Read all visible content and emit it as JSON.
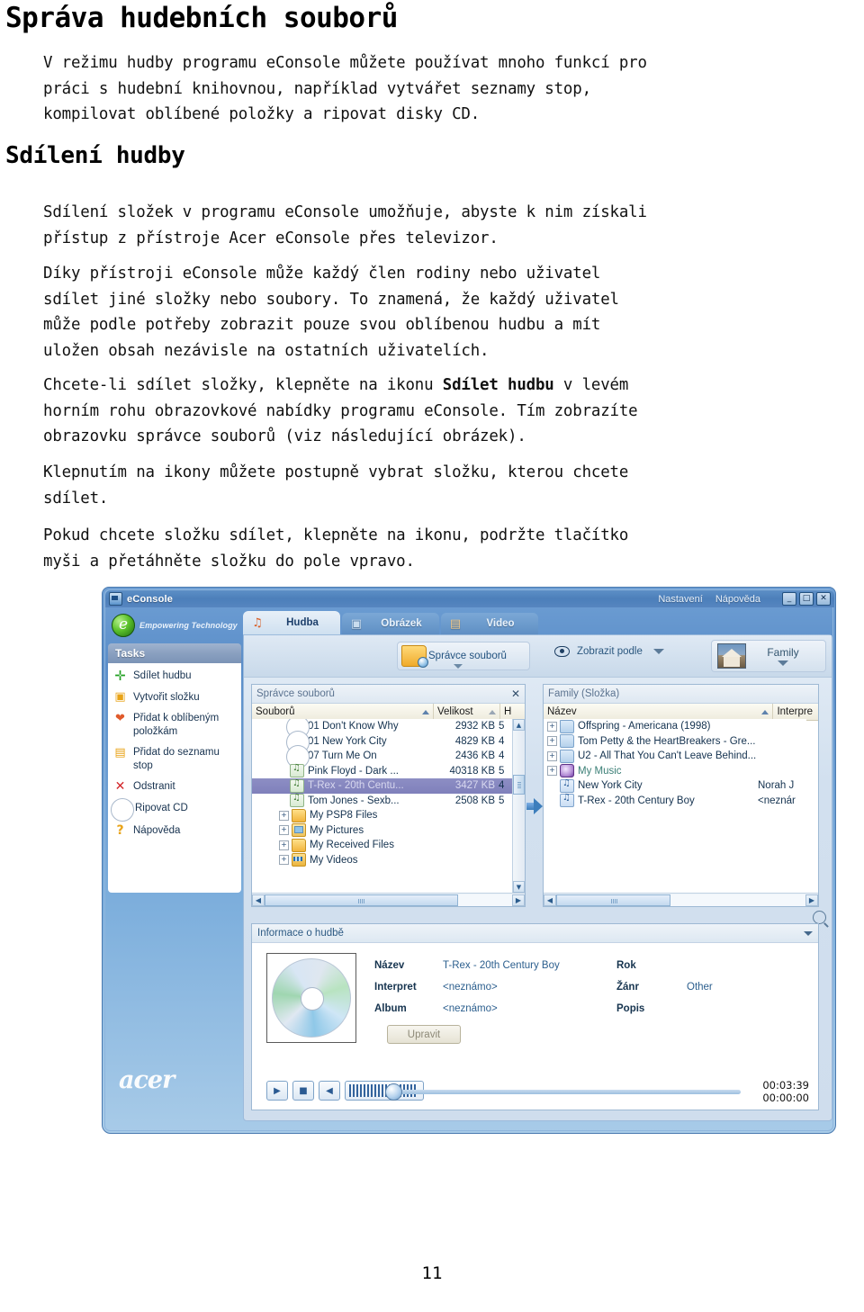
{
  "document": {
    "heading1": "Správa hudebních souborů",
    "heading2": "Sdílení hudby",
    "paragraphs": {
      "p1": "V režimu hudby programu eConsole můžete používat mnoho funkcí pro\npráci s hudební knihovnou, například vytvářet seznamy stop,\nkompilovat oblíbené položky a ripovat disky CD.",
      "p2": "Sdílení složek v programu eConsole umožňuje, abyste k nim získali\npřístup z přístroje Acer eConsole přes televizor.",
      "p3": "Díky přístroji eConsole může každý člen rodiny nebo uživatel\nsdílet jiné složky nebo soubory. To znamená, že každý uživatel\nmůže podle potřeby zobrazit pouze svou oblíbenou hudbu a mít\nuložen obsah nezávisle na ostatních uživatelích.",
      "p4_a": "Chcete-li sdílet složky, klepněte na ikonu ",
      "p4_bold": "Sdílet hudbu",
      "p4_b": " v levém\nhorním rohu obrazovkové nabídky programu eConsole. Tím zobrazíte\nobrazovku správce souborů (viz následující obrázek).",
      "p5": "Klepnutím na ikony můžete postupně vybrat složku, kterou chcete\nsdílet.",
      "p6": "Pokud chcete složku sdílet, klepněte na ikonu, podržte tlačítko\nmyši a přetáhněte složku do pole vpravo."
    },
    "page_number": "11"
  },
  "screenshot": {
    "titlebar": {
      "app_name": "eConsole",
      "settings_label": "Nastavení",
      "help_label": "Nápověda",
      "minimize": "_",
      "maximize": "□",
      "close": "✕"
    },
    "sidebar": {
      "brand": "Empowering Technology",
      "tasks_header": "Tasks",
      "tasks": [
        {
          "label": "Sdílet hudbu",
          "icon": "plus-icon",
          "glyph": "✛"
        },
        {
          "label": "Vytvořit složku",
          "icon": "new-folder-icon",
          "glyph": "▣"
        },
        {
          "label": "Přidat k oblíbeným položkám",
          "icon": "favorites-heart-icon",
          "glyph": "❤"
        },
        {
          "label": "Přidat do seznamu stop",
          "icon": "playlist-folder-icon",
          "glyph": "▤"
        },
        {
          "label": "Odstranit",
          "icon": "delete-x-icon",
          "glyph": "✕"
        },
        {
          "label": "Ripovat CD",
          "icon": "rip-cd-icon",
          "glyph": "◉"
        },
        {
          "label": "Nápověda",
          "icon": "help-question-icon",
          "glyph": "?"
        }
      ],
      "brand_logo": "acer"
    },
    "tabs": [
      {
        "label": "Hudba",
        "icon": "music-note-icon",
        "glyph": "♫",
        "active": true
      },
      {
        "label": "Obrázek",
        "icon": "camera-icon",
        "glyph": "▣",
        "active": false
      },
      {
        "label": "Video",
        "icon": "filmstrip-icon",
        "glyph": "▤",
        "active": false
      }
    ],
    "toolbar": {
      "file_manager_label": "Správce souborů",
      "view_by_label": "Zobrazit podle",
      "family_label": "Family"
    },
    "left_pane": {
      "title": "Správce souborů",
      "close": "✕",
      "columns": [
        "Souborů",
        "Velikost",
        "H"
      ],
      "rows": [
        {
          "name": "01 Don't Know Why",
          "size": "2932 KB",
          "tail": "5",
          "icon": "cd-track-icon",
          "type": "cd",
          "selected": false,
          "indent": 2
        },
        {
          "name": "01 New York City",
          "size": "4829 KB",
          "tail": "4",
          "icon": "cd-track-icon",
          "type": "cd",
          "selected": false,
          "indent": 2
        },
        {
          "name": "07 Turn Me On",
          "size": "2436 KB",
          "tail": "4",
          "icon": "cd-track-icon",
          "type": "cd",
          "selected": false,
          "indent": 2
        },
        {
          "name": "Pink Floyd - Dark ...",
          "size": "40318 KB",
          "tail": "5",
          "icon": "music-file-icon",
          "type": "note",
          "selected": false,
          "indent": 2
        },
        {
          "name": "T-Rex - 20th Centu...",
          "size": "3427 KB",
          "tail": "4",
          "icon": "music-file-icon",
          "type": "note",
          "selected": true,
          "indent": 2
        },
        {
          "name": "Tom Jones - Sexb...",
          "size": "2508 KB",
          "tail": "5",
          "icon": "music-file-icon",
          "type": "note",
          "selected": false,
          "indent": 2
        },
        {
          "name": "My PSP8 Files",
          "size": "",
          "tail": "",
          "icon": "folder-icon",
          "type": "fold",
          "selected": false,
          "indent": 1,
          "expander": "+"
        },
        {
          "name": "My Pictures",
          "size": "",
          "tail": "",
          "icon": "pictures-folder-icon",
          "type": "pic",
          "selected": false,
          "indent": 1,
          "expander": "+"
        },
        {
          "name": "My Received Files",
          "size": "",
          "tail": "",
          "icon": "folder-icon",
          "type": "fold",
          "selected": false,
          "indent": 1,
          "expander": "+"
        },
        {
          "name": "My Videos",
          "size": "",
          "tail": "",
          "icon": "videos-folder-icon",
          "type": "vid",
          "selected": false,
          "indent": 1,
          "expander": "+"
        }
      ]
    },
    "right_pane": {
      "title": "Family (Složka)",
      "columns": [
        "Název",
        "Interpre"
      ],
      "rows": [
        {
          "name": "Offspring - Americana (1998)",
          "artist": "",
          "icon": "folder-icon",
          "type": "fold-blue",
          "expander": "+"
        },
        {
          "name": "Tom Petty & the HeartBreakers - Gre...",
          "artist": "",
          "icon": "folder-icon",
          "type": "fold-blue",
          "expander": "+"
        },
        {
          "name": "U2 - All That You Can't Leave Behind...",
          "artist": "",
          "icon": "folder-icon",
          "type": "fold-blue",
          "expander": "+"
        },
        {
          "name": "My Music",
          "artist": "",
          "icon": "my-music-icon",
          "type": "mymusic",
          "expander": "+",
          "teal": true
        },
        {
          "name": "New York City",
          "artist": "Norah J",
          "icon": "music-file-icon",
          "type": "note-blue",
          "expander": ""
        },
        {
          "name": "T-Rex - 20th Century Boy",
          "artist": "<neznár",
          "icon": "music-file-icon",
          "type": "note-blue",
          "expander": ""
        }
      ]
    },
    "info_panel": {
      "title": "Informace o hudbě",
      "fields_left": [
        {
          "key": "Název",
          "value": "T-Rex - 20th Century Boy"
        },
        {
          "key": "Interpret",
          "value": "<neznámo>"
        },
        {
          "key": "Album",
          "value": "<neznámo>"
        }
      ],
      "fields_right": [
        {
          "key": "Rok",
          "value": ""
        },
        {
          "key": "Žánr",
          "value": "Other"
        },
        {
          "key": "Popis",
          "value": ""
        }
      ],
      "edit_button": "Upravit",
      "player": {
        "play": "▶",
        "stop": "■",
        "volume": "◀",
        "total_time": "00:03:39",
        "current_time": "00:00:00"
      }
    }
  },
  "colors": {
    "window_blue": "#5b8ec9",
    "titlebar_blue": "#4c7fba",
    "selection_purple": "#8d8ec4",
    "accent_green": "#1f9e1f",
    "text_dark": "#14324f"
  }
}
